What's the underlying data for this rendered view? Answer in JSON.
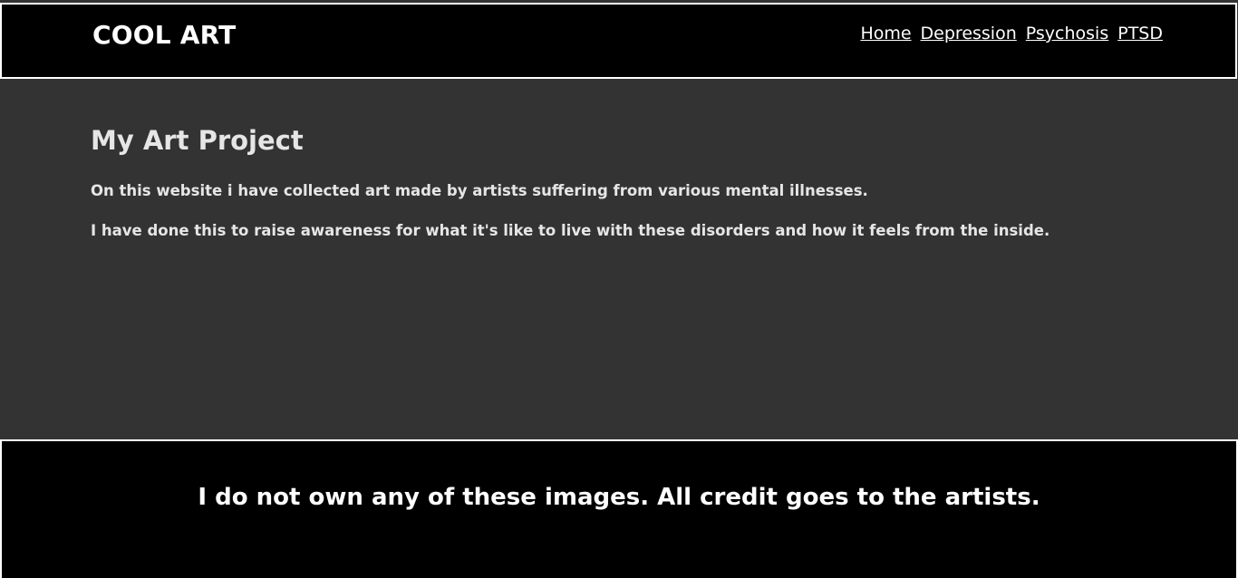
{
  "header": {
    "logo": "COOL ART",
    "nav": [
      {
        "label": "Home"
      },
      {
        "label": "Depression"
      },
      {
        "label": "Psychosis"
      },
      {
        "label": "PTSD"
      }
    ]
  },
  "main": {
    "title": "My Art Project",
    "paragraphs": [
      "On this website i have collected art made by artists suffering from various mental illnesses.",
      "I have done this to raise awareness for what it's like to live with these disorders and how it feels from the inside."
    ]
  },
  "footer": {
    "disclaimer": "I do not own any of these images. All credit goes to the artists."
  },
  "colors": {
    "header_bg": "#000000",
    "main_bg": "#333333",
    "text": "#ffffff",
    "border": "#ffffff"
  }
}
